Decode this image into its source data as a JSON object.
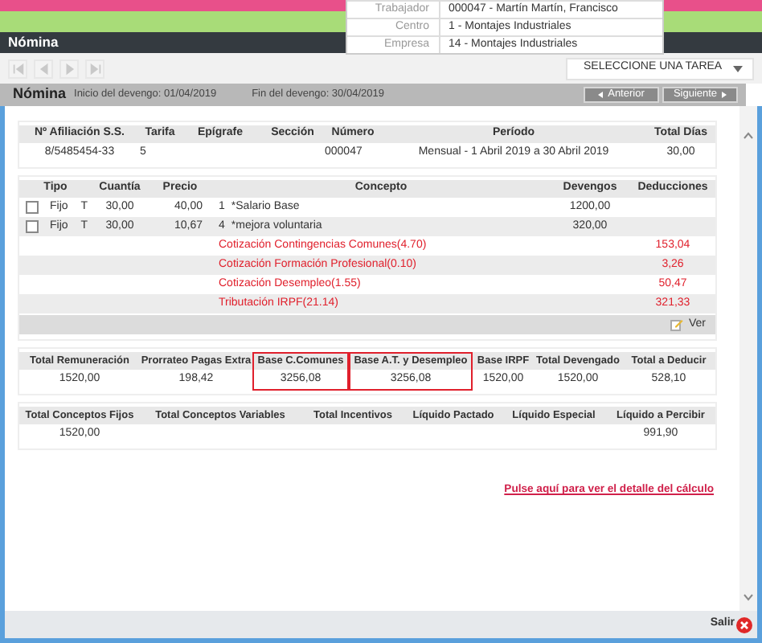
{
  "window": {
    "title": "Nómina"
  },
  "worker_info": [
    {
      "label": "Trabajador",
      "value": "000047 - Martín Martín, Francisco"
    },
    {
      "label": "Centro",
      "value": "1 - Montajes Industriales"
    },
    {
      "label": "Empresa",
      "value": "14 - Montajes Industriales"
    }
  ],
  "nav_buttons": [
    {
      "kind": "first",
      "disabled": true
    },
    {
      "kind": "prev",
      "disabled": true
    },
    {
      "kind": "next",
      "disabled": true
    },
    {
      "kind": "last",
      "disabled": true
    }
  ],
  "task_select": {
    "label": "SELECCIONE UNA TAREA"
  },
  "payroll_header": {
    "title": "Nómina",
    "start": "Inicio del devengo: 01/04/2019",
    "end": "Fin del devengo: 30/04/2019",
    "buttons": [
      {
        "label": "Anterior",
        "kind": "prev",
        "disabled": true
      },
      {
        "label": "Siguiente",
        "kind": "next",
        "disabled": true
      }
    ]
  },
  "affiliation_table": {
    "columns": [
      {
        "label": "Nº Afiliación S.S.",
        "value": "8/5485454-33"
      },
      {
        "label": "Tarifa",
        "value": "5"
      },
      {
        "label": "Epígrafe"
      },
      {
        "label": "Sección"
      },
      {
        "label": "Número",
        "value": "000047"
      },
      {
        "label": "Período",
        "value": "Mensual - 1 Abril 2019 a 30 Abril 2019"
      },
      {
        "label": "Total Días",
        "value": "30,00"
      }
    ]
  },
  "concepts_table": {
    "columns": [
      "Tipo",
      "Cuantía",
      "Precio",
      "Concepto",
      "Devengos",
      "Deducciones"
    ],
    "rows": [
      {
        "kind": "item",
        "checked": false,
        "tipo": "Fijo",
        "t": "T",
        "cuantia": "30,00",
        "precio": "40,00",
        "code": "1",
        "concepto": "*Salario Base",
        "devengos": "1200,00"
      },
      {
        "kind": "item",
        "checked": false,
        "tipo": "Fijo",
        "t": "T",
        "cuantia": "30,00",
        "precio": "10,67",
        "code": "4",
        "concepto": "*mejora voluntaria",
        "devengos": "320,00"
      },
      {
        "kind": "deduction",
        "concepto": "Cotización Contingencias Comunes(4.70)",
        "deducciones": "153,04"
      },
      {
        "kind": "deduction",
        "concepto": "Cotización Formación Profesional(0.10)",
        "deducciones": "3,26"
      },
      {
        "kind": "deduction",
        "concepto": "Cotización Desempleo(1.55)",
        "deducciones": "50,47"
      },
      {
        "kind": "deduction",
        "concepto": "Tributación IRPF(21.14)",
        "deducciones": "321,33"
      }
    ],
    "view_button": "Ver"
  },
  "totals_table": {
    "columns": [
      {
        "label": "Total Remuneración",
        "highlighted": false
      },
      {
        "label": "Prorrateo Pagas Extra",
        "highlighted": false
      },
      {
        "label": "Base C.Comunes",
        "highlighted": true
      },
      {
        "label": "Base A.T. y Desempleo",
        "highlighted": true
      },
      {
        "label": "Base IRPF",
        "highlighted": false
      },
      {
        "label": "Total Devengado",
        "highlighted": false
      },
      {
        "label": "Total a Deducir",
        "highlighted": false
      }
    ],
    "values": [
      "1520,00",
      "198,42",
      "3256,08",
      "3256,08",
      "1520,00",
      "1520,00",
      "528,10"
    ]
  },
  "summary_table": {
    "columns": [
      {
        "label": "Total Conceptos Fijos",
        "value": "1520,00"
      },
      {
        "label": "Total Conceptos Variables"
      },
      {
        "label": "Total Incentivos"
      },
      {
        "label": "Líquido Pactado"
      },
      {
        "label": "Líquido Especial"
      },
      {
        "label": "Líquido a Percibir",
        "value": "991,90"
      }
    ]
  },
  "detail_link": "Pulse aquí para ver el detalle del cálculo",
  "footer": {
    "exit_button": "Salir"
  }
}
